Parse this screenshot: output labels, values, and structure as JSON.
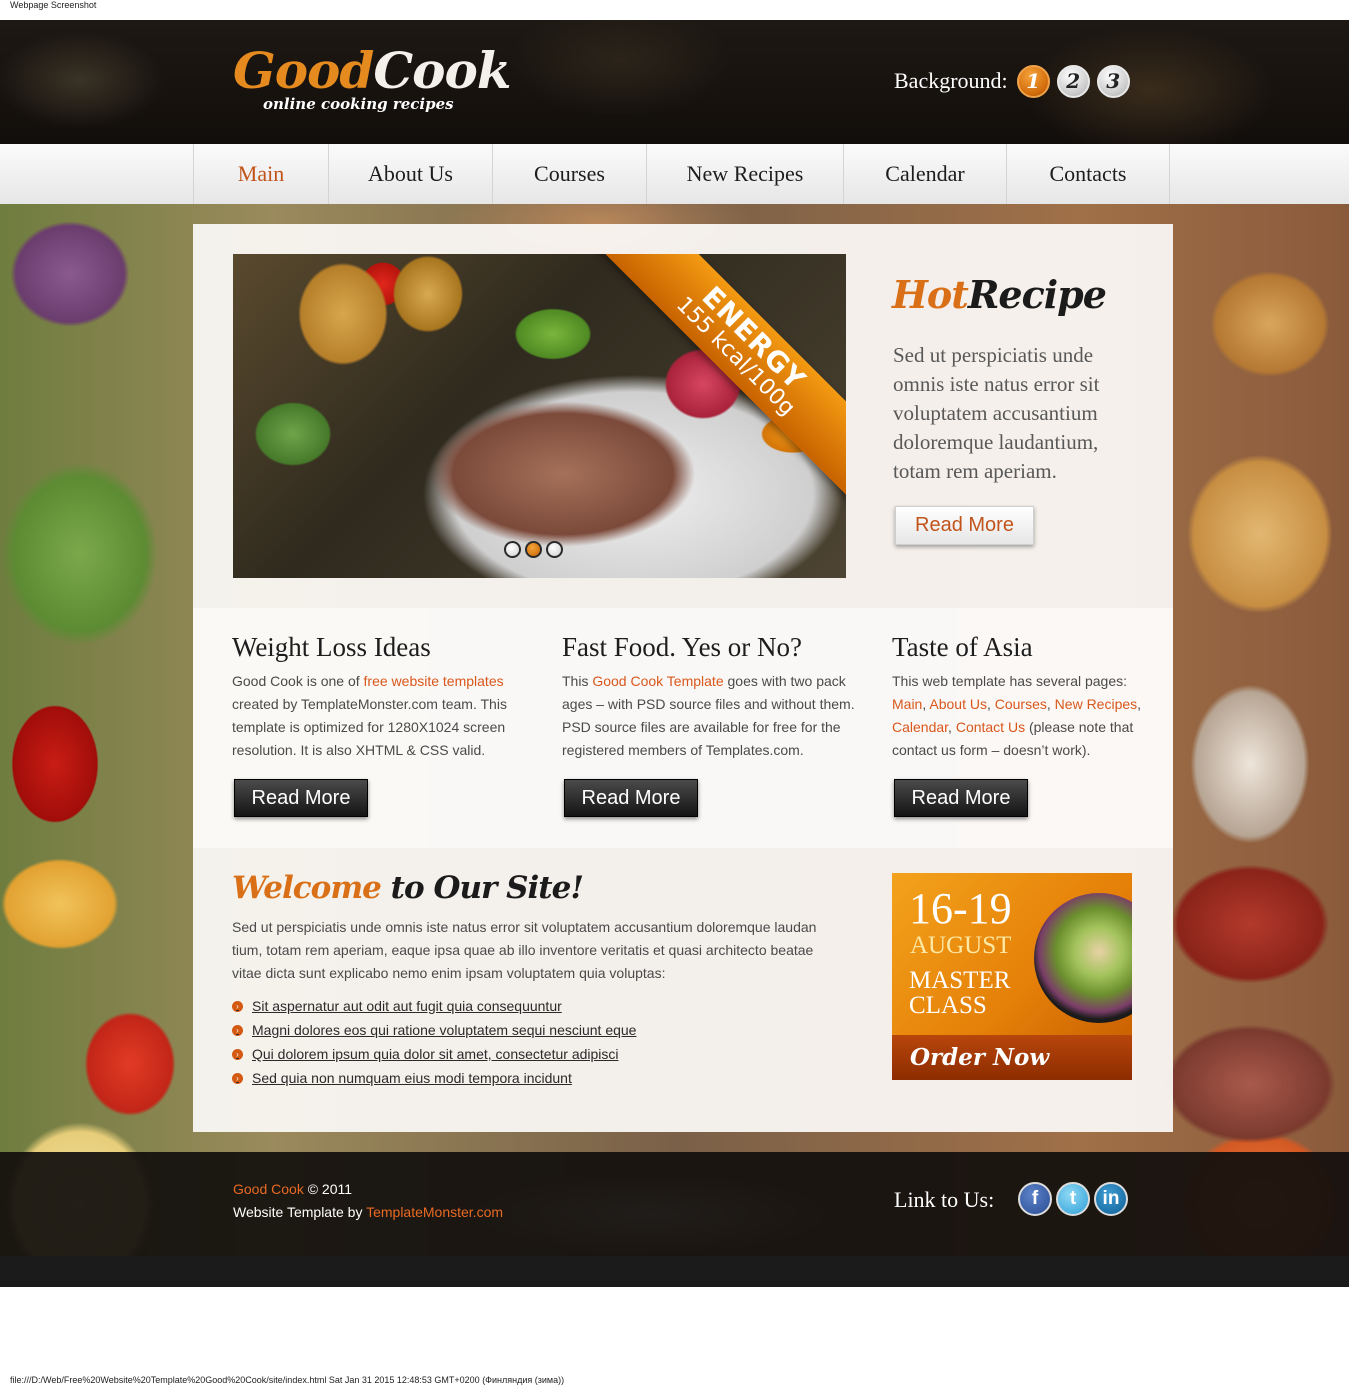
{
  "screenshot_caption": "Webpage Screenshot",
  "footer_caption": "file:///D:/Web/Free%20Website%20Template%20Good%20Cook/site/index.html Sat Jan 31 2015 12:48:53 GMT+0200 (Финляндия (зима))",
  "logo": {
    "word1": "Good",
    "word2": "Cook",
    "tagline": "online cooking recipes"
  },
  "background_switch": {
    "label": "Background:",
    "options": [
      "1",
      "2",
      "3"
    ],
    "selected": "1"
  },
  "nav": {
    "items": [
      "Main",
      "About Us",
      "Courses",
      "New Recipes",
      "Calendar",
      "Contacts"
    ],
    "active": "Main"
  },
  "slider": {
    "ribbon_title": "ENERGY",
    "ribbon_sub": "155 kcal/100g",
    "active_dot": 2,
    "dot_count": 3
  },
  "hot_recipe": {
    "title_part1": "Hot",
    "title_part2": "Recipe",
    "text": "Sed ut perspiciatis unde omnis iste natus error sit voluptatem accusantium doloremque laudantium, totam rem aperiam.",
    "button": "Read More"
  },
  "columns": [
    {
      "title": "Weight Loss Ideas",
      "pre": "Good Cook is one of ",
      "link": "free website templates",
      "post": " created by TemplateMonster.com team. This template is optimized for 1280X1024 screen resolution. It is also XHTML & CSS valid.",
      "button": "Read More"
    },
    {
      "title": "Fast Food. Yes or No?",
      "pre": "This ",
      "link": "Good Cook Template",
      "post": " goes with two pack ages – with PSD source files and without them. PSD source files are available for free for the registered members of Templates.com.",
      "button": "Read More"
    },
    {
      "title": "Taste of Asia",
      "pre": "This web template has several pages: ",
      "links": [
        "Main",
        "About Us",
        "Courses",
        "New Recipes",
        "Calendar",
        "Contact Us"
      ],
      "post": " (please note that contact us form – doesn’t work).",
      "button": "Read More"
    }
  ],
  "welcome": {
    "title_part1": "Welcome",
    "title_part2": " to Our Site!",
    "text": "Sed ut perspiciatis unde omnis iste natus error sit voluptatem accusantium doloremque laudan tium, totam rem aperiam, eaque ipsa quae ab illo inventore veritatis et quasi architecto beatae vitae dicta sunt explicabo nemo enim ipsam voluptatem quia voluptas:",
    "items": [
      "Sit aspernatur aut odit aut fugit quia consequuntur",
      "Magni dolores eos qui ratione voluptatem sequi nesciunt eque",
      "Qui dolorem ipsum quia dolor sit amet, consectetur adipisci",
      "Sed quia non numquam eius modi tempora incidunt"
    ]
  },
  "promo": {
    "dates": "16-19",
    "month": "AUGUST",
    "line1": "MASTER",
    "line2": "CLASS",
    "cta": "Order Now"
  },
  "footer": {
    "brand": "Good Cook",
    "copyright": " © 2011",
    "template_by": "Website Template by ",
    "template_link": "TemplateMonster.com",
    "links_label": "Link to Us:",
    "social": [
      {
        "icon": "facebook-icon",
        "glyph": "f"
      },
      {
        "icon": "twitter-icon",
        "glyph": "t"
      },
      {
        "icon": "linkedin-icon",
        "glyph": "in"
      }
    ]
  },
  "colors": {
    "accent": "#d9571c",
    "logo_orange": "#e58a1f",
    "dark": "#141414",
    "promo_orange": "#e58008"
  }
}
